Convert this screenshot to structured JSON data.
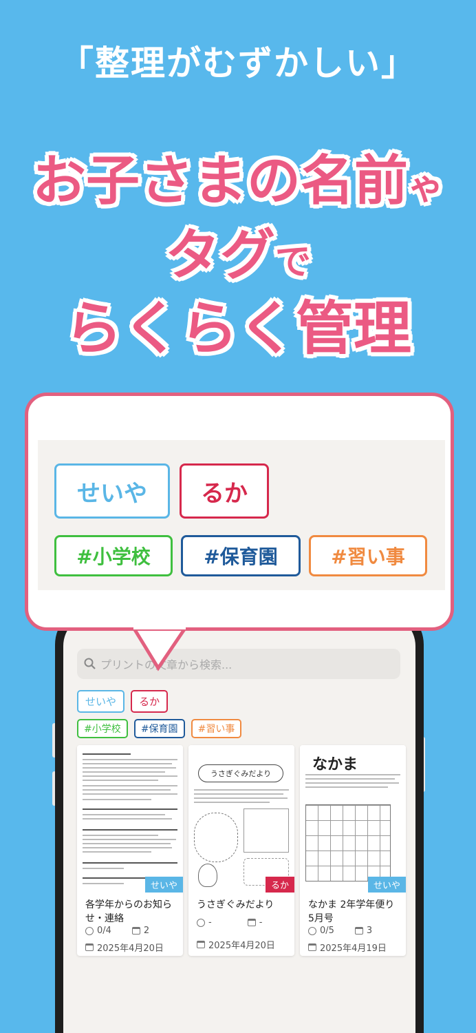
{
  "headline": {
    "subtitle": "「整理がむずかしい」",
    "line1_main": "お子さまの名前",
    "line1_small": "ゃ",
    "line2_main": "タグ",
    "line2_small": "で",
    "line3": "らくらく管理"
  },
  "callout": {
    "children": [
      {
        "label": "せいや",
        "color": "#5ab6e6"
      },
      {
        "label": "るか",
        "color": "#d6284c"
      }
    ],
    "tags": [
      {
        "label": "#小学校",
        "color": "#3fbf3f"
      },
      {
        "label": "#保育園",
        "color": "#1f5a9a"
      },
      {
        "label": "#習い事",
        "color": "#f08a40"
      }
    ]
  },
  "app": {
    "search_placeholder": "プリントの文章から検索...",
    "children": [
      {
        "label": "せいや",
        "color": "#5ab6e6"
      },
      {
        "label": "るか",
        "color": "#d6284c"
      }
    ],
    "tags": [
      {
        "label": "#小学校",
        "color": "#3fbf3f"
      },
      {
        "label": "#保育園",
        "color": "#1f5a9a"
      },
      {
        "label": "#習い事",
        "color": "#f08a40"
      }
    ],
    "cards": [
      {
        "title": "各学年からのお知らせ・連絡",
        "badge": "せいや",
        "badge_color": "#5ab6e6",
        "tasks": "0/4",
        "events": "2",
        "date": "2025年4月20日"
      },
      {
        "title": "うさぎぐみだより",
        "badge": "るか",
        "badge_color": "#d6284c",
        "tasks": "-",
        "events": "-",
        "date": "2025年4月20日"
      },
      {
        "title": "なかま 2年学年便り 5月号",
        "badge": "せいや",
        "badge_color": "#5ab6e6",
        "tasks": "0/5",
        "events": "3",
        "date": "2025年4月19日"
      }
    ],
    "thumb_texts": {
      "usagi": "うさぎぐみだより",
      "nakama": "なかま"
    }
  }
}
